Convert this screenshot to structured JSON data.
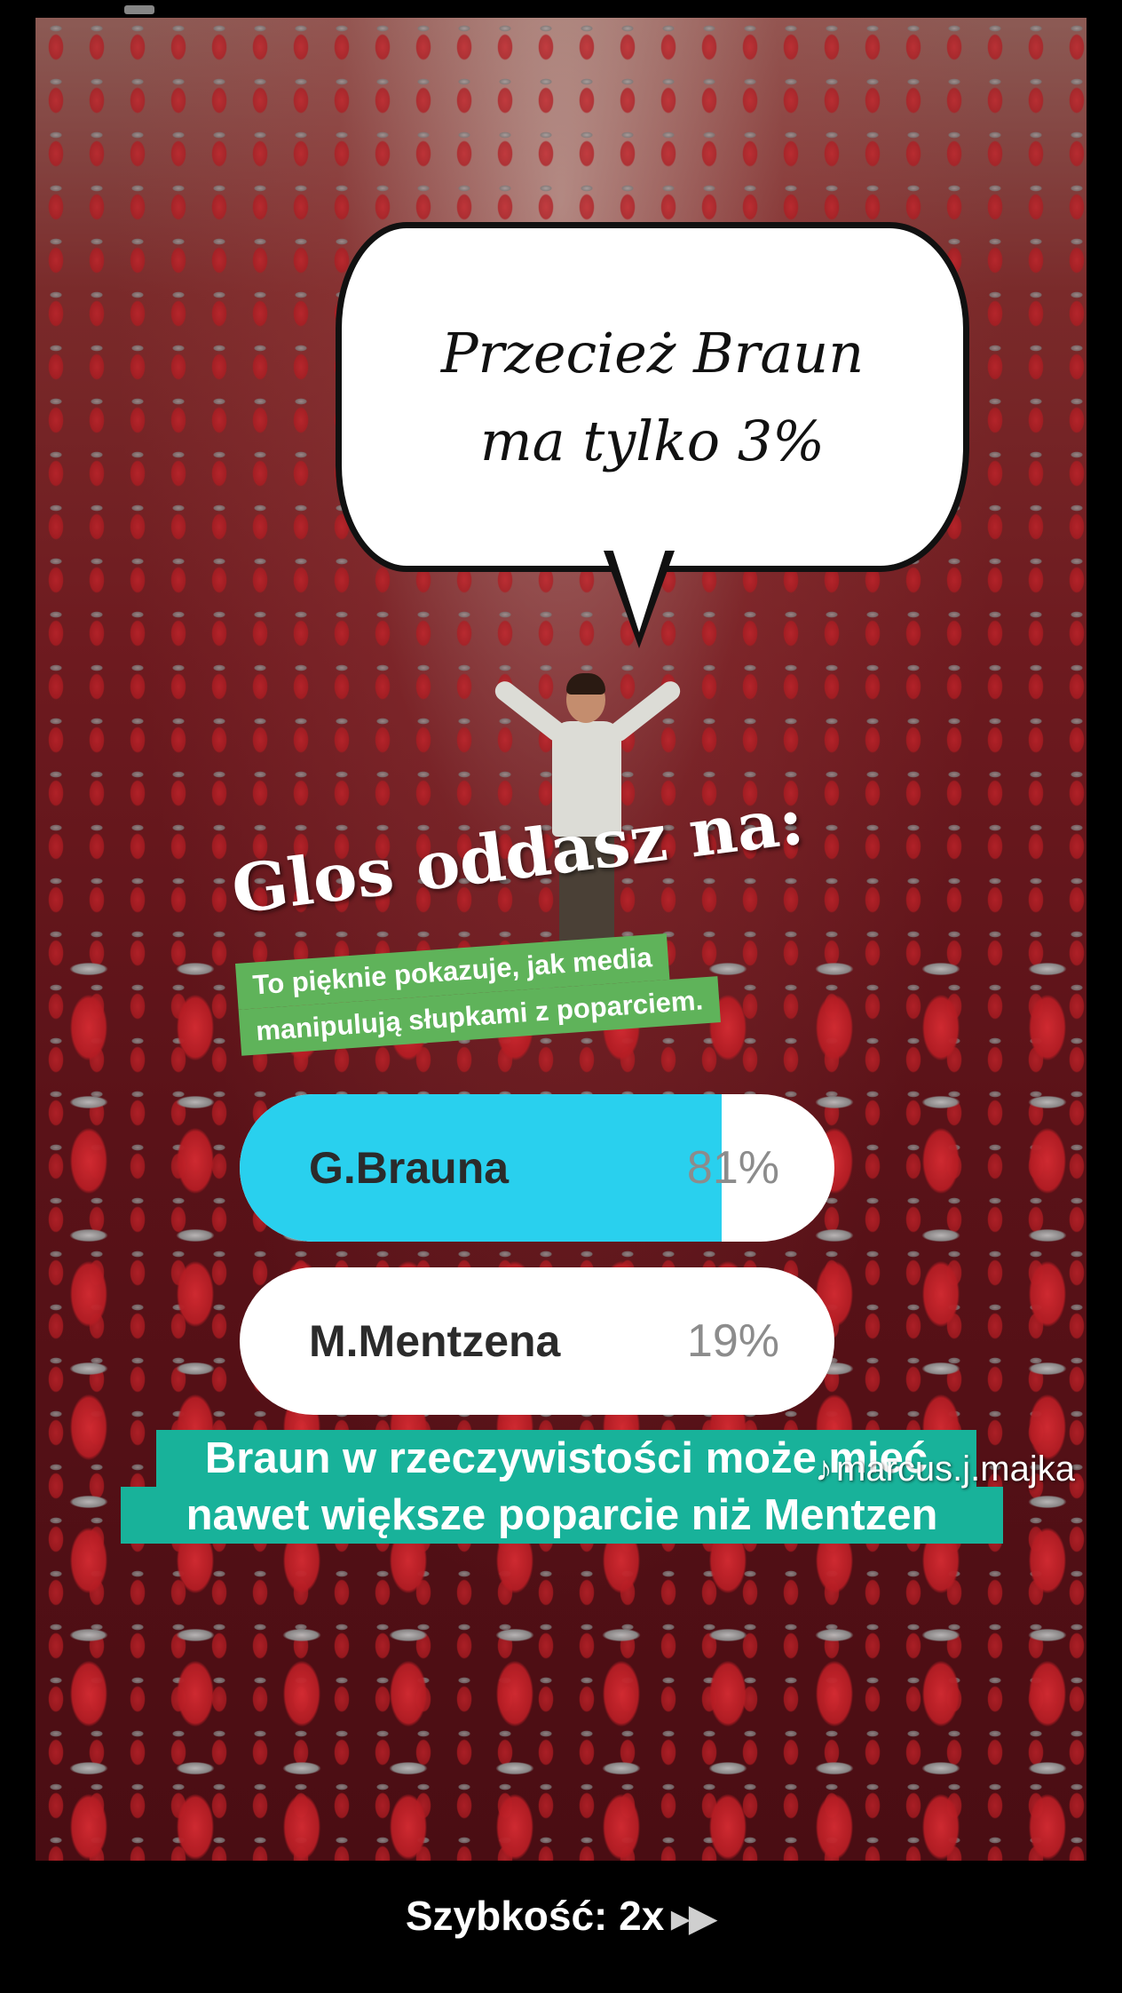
{
  "meme": {
    "bubble_line1": "Przecież Braun",
    "bubble_line2": "ma tylko 3%"
  },
  "poll": {
    "title": "Glos oddasz na:",
    "caption_line1": "To pięknie pokazuje, jak media",
    "caption_line2": "manipulują słupkami z poparciem.",
    "options": [
      {
        "name": "G.Brauna",
        "percent_label": "81%",
        "percent": 81,
        "highlighted": true
      },
      {
        "name": "M.Mentzena",
        "percent_label": "19%",
        "percent": 19,
        "highlighted": false
      }
    ]
  },
  "caption": {
    "line1": "Braun w rzeczywistości może mieć",
    "line2": "nawet większe poparcie niż Mentzen"
  },
  "watermark": {
    "handle": "marcus.j.majka",
    "icon": "tiktok-note-icon"
  },
  "player": {
    "speed_label": "Szybkość: 2x",
    "speed_icon": "fast-forward-icon"
  },
  "colors": {
    "poll_fill": "#29d0ee",
    "green_caption": "#5fb35a",
    "teal_caption": "#18b29a"
  }
}
